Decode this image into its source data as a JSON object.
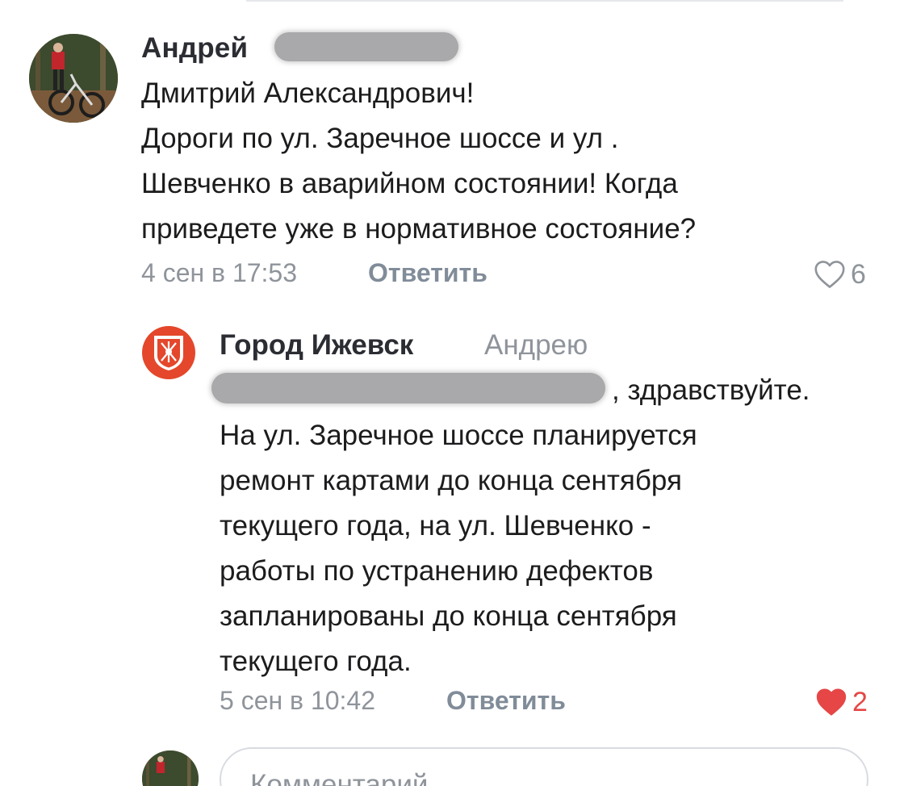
{
  "comment": {
    "author": "Андрей",
    "text_lines": [
      "Дмитрий Александрович!",
      "Дороги по ул. Заречное шоссе и ул .",
      "Шевченко в аварийном состоянии! Когда",
      "приведете уже в нормативное состояние?"
    ],
    "date": "4 сен в 17:53",
    "reply_label": "Ответить",
    "likes": "6",
    "liked": false
  },
  "reply": {
    "author": "Город Ижевск",
    "reply_to": "Андрею",
    "text_lines": [
      ", здравствуйте.",
      "На ул. Заречное шоссе планируется",
      "ремонт картами до конца сентября",
      "текущего года, на ул. Шевченко -",
      "работы по устранению дефектов",
      "запланированы до конца сентября",
      "текущего года."
    ],
    "date": "5 сен в 10:42",
    "reply_label": "Ответить",
    "likes": "2",
    "liked": true
  },
  "composer": {
    "placeholder": "Комментарий"
  },
  "colors": {
    "meta": "#8f949b",
    "like_active": "#e64646",
    "city_avatar": "#e4472b"
  },
  "icons": {
    "like_empty": "heart-outline-icon",
    "like_filled": "heart-filled-icon"
  }
}
